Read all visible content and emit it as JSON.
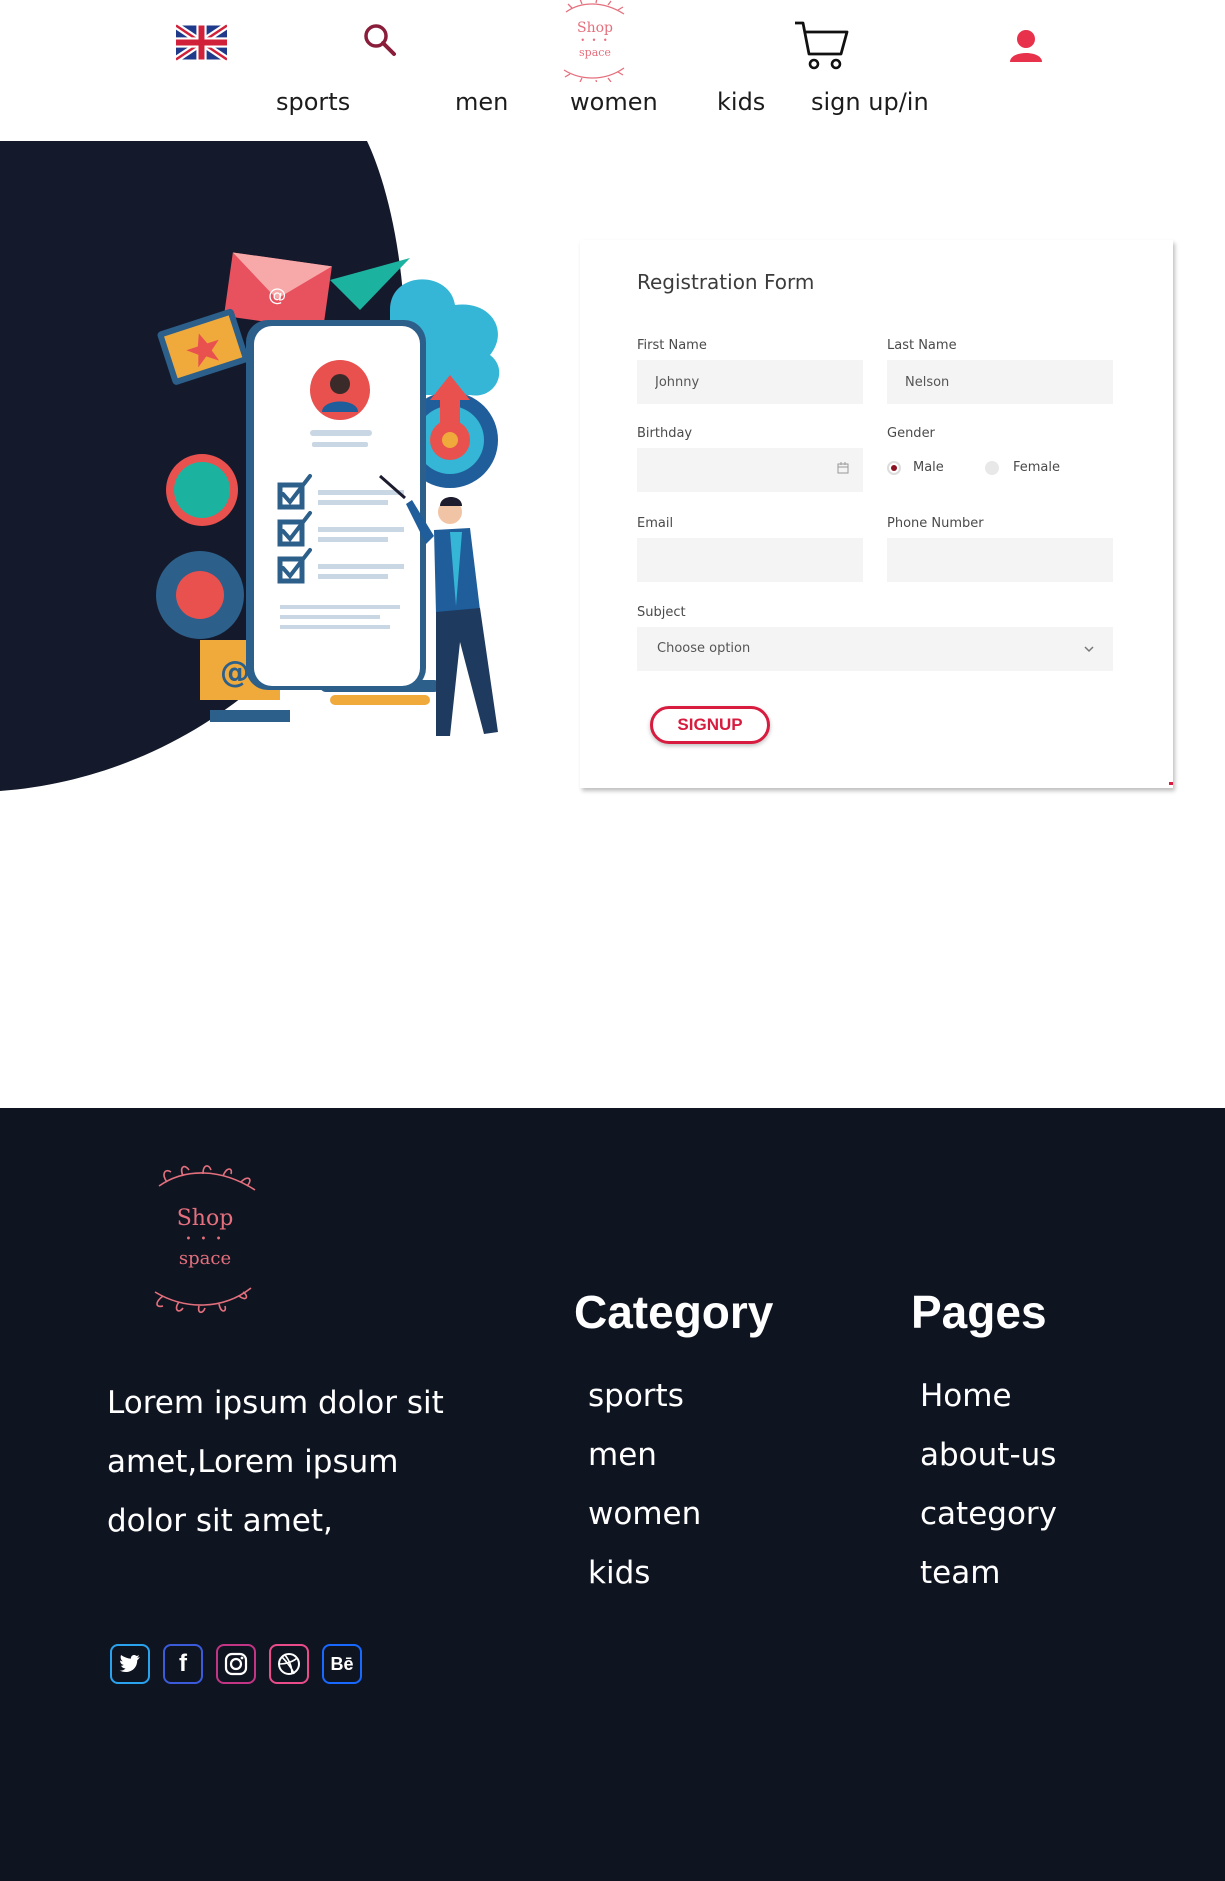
{
  "header": {
    "logo_line1": "Shop",
    "logo_line2": "space",
    "nav": [
      "sports",
      "men",
      "women",
      "kids",
      "sign up/in"
    ]
  },
  "form": {
    "title": "Registration Form",
    "first_name_label": "First Name",
    "first_name_value": "Johnny",
    "last_name_label": "Last Name",
    "last_name_value": "Nelson",
    "birthday_label": "Birthday",
    "gender_label": "Gender",
    "gender_options": [
      "Male",
      "Female"
    ],
    "gender_selected": "Male",
    "email_label": "Email",
    "phone_label": "Phone Number",
    "subject_label": "Subject",
    "subject_selected": "Choose option",
    "signup_label": "SIGNUP"
  },
  "footer": {
    "logo_line1": "Shop",
    "logo_line2": "space",
    "about_text": "Lorem ipsum dolor sit amet,Lorem ipsum dolor sit amet,",
    "category_heading": "Category",
    "category_links": [
      "sports",
      "men",
      "women",
      "kids"
    ],
    "pages_heading": "Pages",
    "pages_links": [
      "Home",
      "about-us",
      "category",
      "team"
    ],
    "social": [
      {
        "icon": "twitter-icon",
        "glyph": "🐦",
        "color": "#2aa3ef"
      },
      {
        "icon": "facebook-icon",
        "glyph": "f",
        "color": "#3b5bdb"
      },
      {
        "icon": "instagram-icon",
        "glyph": "◎",
        "color": "#c13584"
      },
      {
        "icon": "dribbble-icon",
        "glyph": "⊛",
        "color": "#ea4c89"
      },
      {
        "icon": "behance-icon",
        "glyph": "Bē",
        "color": "#1769ff"
      }
    ]
  },
  "colors": {
    "dark": "#0f1421",
    "accent": "#e8314b",
    "signup": "#d81c3f",
    "logo": "#e5707d"
  }
}
